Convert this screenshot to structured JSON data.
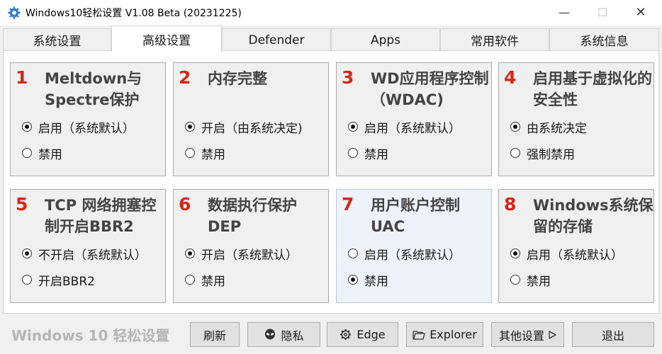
{
  "window": {
    "title": "Windows10轻松设置 V1.08 Beta (20231225)"
  },
  "window_controls": {
    "minimize": "—",
    "maximize": "☐",
    "close": "✕"
  },
  "tabs": [
    {
      "label": "系统设置",
      "active": false
    },
    {
      "label": "高级设置",
      "active": true
    },
    {
      "label": "Defender",
      "active": false
    },
    {
      "label": "Apps",
      "active": false
    },
    {
      "label": "常用软件",
      "active": false
    },
    {
      "label": "系统信息",
      "active": false
    }
  ],
  "groups": [
    {
      "number": "1",
      "title": "Meltdown与Spectre保护",
      "options": [
        "启用（系统默认）",
        "禁用"
      ],
      "selected": 0
    },
    {
      "number": "2",
      "title": "内存完整",
      "options": [
        "开启（由系统决定)",
        "禁用"
      ],
      "selected": 0
    },
    {
      "number": "3",
      "title": "WD应用程序控制（WDAC)",
      "options": [
        "启用（系统默认）",
        "禁用"
      ],
      "selected": 0
    },
    {
      "number": "4",
      "title": "启用基于虚拟化的安全性",
      "options": [
        "由系统决定",
        "强制禁用"
      ],
      "selected": 0
    },
    {
      "number": "5",
      "title": "TCP 网络拥塞控制开启BBR2",
      "options": [
        "不开启（系统默认）",
        "开启BBR2"
      ],
      "selected": 0
    },
    {
      "number": "6",
      "title": "数据执行保护DEP",
      "options": [
        "开启（系统默认）",
        "禁用"
      ],
      "selected": 0
    },
    {
      "number": "7",
      "title": "用户账户控制UAC",
      "options": [
        "启用（系统默认）",
        "禁用"
      ],
      "selected": 1
    },
    {
      "number": "8",
      "title": "Windows系统保留的存储",
      "options": [
        "启用（系统默认）",
        "禁用"
      ],
      "selected": 0
    }
  ],
  "footer": {
    "brand": "Windows 10 轻松设置",
    "buttons": [
      {
        "label": "刷新",
        "icon": ""
      },
      {
        "label": "隐私",
        "icon": "alien-icon"
      },
      {
        "label": "Edge",
        "icon": "gear-icon"
      },
      {
        "label": "Explorer",
        "icon": "folder-icon"
      },
      {
        "label": "其他设置",
        "icon": "play-arrow-icon"
      },
      {
        "label": "退出",
        "icon": ""
      }
    ]
  },
  "colors": {
    "accent_number": "#d62718",
    "title_text": "#444444",
    "brand": "#b5b5b5"
  }
}
